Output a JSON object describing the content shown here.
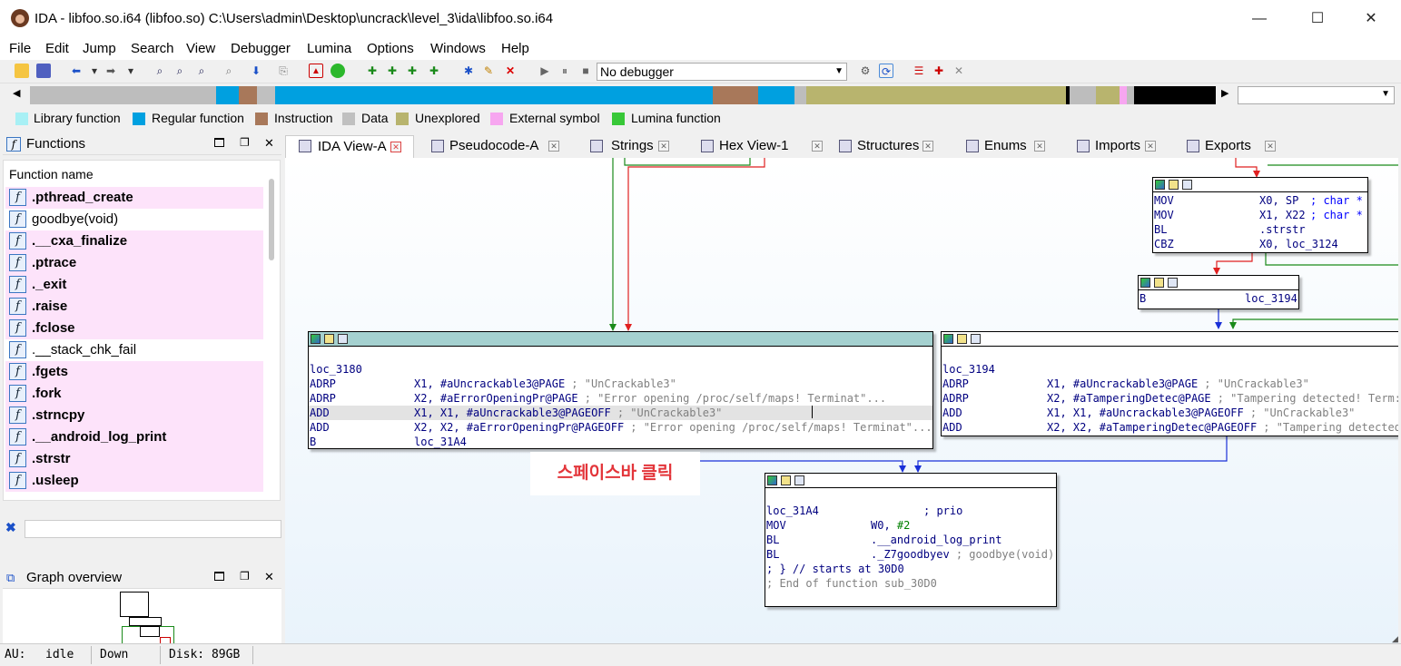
{
  "window": {
    "title": "IDA - libfoo.so.i64 (libfoo.so) C:\\Users\\admin\\Desktop\\uncrack\\level_3\\ida\\libfoo.so.i64",
    "minimize": "—",
    "maximize": "☐",
    "close": "✕"
  },
  "menu": [
    "File",
    "Edit",
    "Jump",
    "Search",
    "View",
    "Debugger",
    "Lumina",
    "Options",
    "Windows",
    "Help"
  ],
  "toolbar": {
    "debugger_select": "No debugger"
  },
  "legend": [
    {
      "label": "Library function",
      "color": "#a8f0f5"
    },
    {
      "label": "Regular function",
      "color": "#00a0e0"
    },
    {
      "label": "Instruction",
      "color": "#a8785a"
    },
    {
      "label": "Data",
      "color": "#c0c0c0"
    },
    {
      "label": "Unexplored",
      "color": "#b8b46e"
    },
    {
      "label": "External symbol",
      "color": "#f7a6f0"
    },
    {
      "label": "Lumina function",
      "color": "#38c838"
    }
  ],
  "functions_panel": {
    "title": "Functions",
    "column_header": "Function name",
    "items": [
      {
        "name": ".pthread_create",
        "bold": true
      },
      {
        "name": "goodbye(void)",
        "bold": false
      },
      {
        "name": ".__cxa_finalize",
        "bold": true
      },
      {
        "name": ".ptrace",
        "bold": true
      },
      {
        "name": "._exit",
        "bold": true
      },
      {
        "name": ".raise",
        "bold": true
      },
      {
        "name": ".fclose",
        "bold": true
      },
      {
        "name": ".__stack_chk_fail",
        "bold": false
      },
      {
        "name": ".fgets",
        "bold": true
      },
      {
        "name": ".fork",
        "bold": true
      },
      {
        "name": ".strncpy",
        "bold": true
      },
      {
        "name": ".__android_log_print",
        "bold": true
      },
      {
        "name": ".strstr",
        "bold": true
      },
      {
        "name": ".usleep",
        "bold": true
      }
    ]
  },
  "graph_overview": {
    "title": "Graph overview"
  },
  "tabs": [
    {
      "label": "IDA View-A",
      "active": true
    },
    {
      "label": "Pseudocode-A",
      "active": false
    },
    {
      "label": "Strings",
      "active": false
    },
    {
      "label": "Hex View-1",
      "active": false
    },
    {
      "label": "Structures",
      "active": false
    },
    {
      "label": "Enums",
      "active": false
    },
    {
      "label": "Imports",
      "active": false
    },
    {
      "label": "Exports",
      "active": false
    }
  ],
  "nodes": {
    "top_right": [
      {
        "op": "MOV",
        "args": "X0, SP",
        "cmt": "; char *"
      },
      {
        "op": "MOV",
        "args": "X1, X22",
        "cmt": "; char *"
      },
      {
        "op": "BL",
        "args": ".strstr",
        "cmt": ""
      },
      {
        "op": "CBZ",
        "args": "X0, loc_3124",
        "cmt": ""
      }
    ],
    "branch": {
      "op": "B",
      "args": "loc_3194"
    },
    "loc_3180": {
      "label": "loc_3180",
      "lines": [
        {
          "op": "ADRP",
          "args": "X1, #aUncrackable3@PAGE",
          "cmt": "; \"UnCrackable3\""
        },
        {
          "op": "ADRP",
          "args": "X2, #aErrorOpeningPr@PAGE",
          "cmt": "; \"Error opening /proc/self/maps! Terminat\"..."
        },
        {
          "op": "ADD",
          "args": "X1, X1, #aUncrackable3@PAGEOFF",
          "cmt": "; \"UnCrackable3\""
        },
        {
          "op": "ADD",
          "args": "X2, X2, #aErrorOpeningPr@PAGEOFF",
          "cmt": "; \"Error opening /proc/self/maps! Terminat\"..."
        },
        {
          "op": "B",
          "args": "loc_31A4",
          "cmt": ""
        }
      ]
    },
    "loc_3194": {
      "label": "loc_3194",
      "lines": [
        {
          "op": "ADRP",
          "args": "X1, #aUncrackable3@PAGE",
          "cmt": "; \"UnCrackable3\""
        },
        {
          "op": "ADRP",
          "args": "X2, #aTamperingDetec@PAGE",
          "cmt": "; \"Tampering detected! Term:"
        },
        {
          "op": "ADD",
          "args": "X1, X1, #aUncrackable3@PAGEOFF",
          "cmt": "; \"UnCrackable3\""
        },
        {
          "op": "ADD",
          "args": "X2, X2, #aTamperingDetec@PAGEOFF",
          "cmt": "; \"Tampering detected"
        }
      ]
    },
    "loc_31A4": {
      "label": "loc_31A4",
      "label_cmt": "; prio",
      "lines": [
        {
          "op": "MOV",
          "args": "W0, ",
          "num": "#2",
          "cmt": ""
        },
        {
          "op": "BL",
          "args": ".__android_log_print",
          "cmt": ""
        },
        {
          "op": "BL",
          "args": "._Z7goodbyev",
          "cmt": "; goodbye(void)"
        }
      ],
      "end1": "; } // starts at 30D0",
      "end2": "; End of function sub_30D0"
    }
  },
  "caption": "스페이스바 클릭",
  "status": {
    "au": "AU:",
    "state": "idle",
    "dir": "Down",
    "disk": "Disk: 89GB"
  }
}
